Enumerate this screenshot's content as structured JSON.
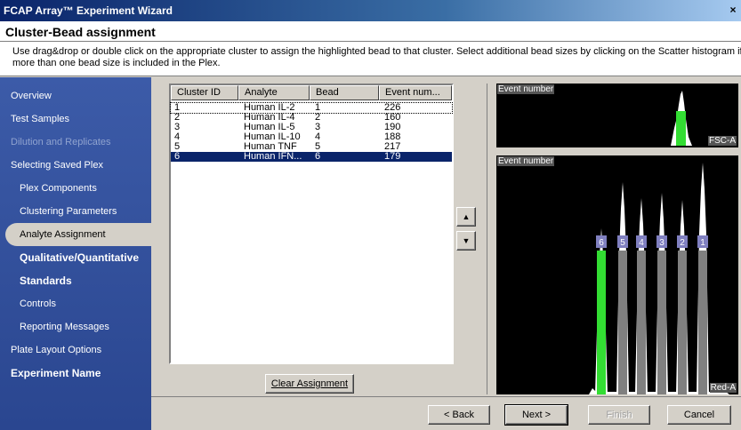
{
  "window": {
    "title": "FCAP Array™ Experiment Wizard",
    "close_glyph": "×"
  },
  "header": {
    "title": "Cluster-Bead assignment",
    "description": "Use drag&drop or double click on the appropriate cluster to assign the highlighted bead to that cluster. Select additional bead sizes by clicking on the Scatter histogram if more than one bead size is included in the Plex."
  },
  "nav": {
    "items": [
      {
        "label": "Overview",
        "level": 0,
        "state": "normal"
      },
      {
        "label": "Test Samples",
        "level": 0,
        "state": "normal"
      },
      {
        "label": "Dilution and Replicates",
        "level": 0,
        "state": "disabled"
      },
      {
        "label": "Selecting Saved Plex",
        "level": 0,
        "state": "normal"
      },
      {
        "label": "Plex Components",
        "level": 1,
        "state": "normal"
      },
      {
        "label": "Clustering Parameters",
        "level": 1,
        "state": "normal"
      },
      {
        "label": "Analyte Assignment",
        "level": 1,
        "state": "selected"
      },
      {
        "label": "Qualitative/Quantitative",
        "level": 1,
        "state": "bold"
      },
      {
        "label": "Standards",
        "level": 1,
        "state": "bold"
      },
      {
        "label": "Controls",
        "level": 1,
        "state": "normal"
      },
      {
        "label": "Reporting Messages",
        "level": 1,
        "state": "normal"
      },
      {
        "label": "Plate Layout Options",
        "level": 0,
        "state": "normal"
      },
      {
        "label": "Experiment Name",
        "level": 0,
        "state": "bold"
      }
    ]
  },
  "table": {
    "columns": [
      "Cluster ID",
      "Analyte",
      "Bead",
      "Event num..."
    ],
    "rows": [
      {
        "cluster": "1",
        "analyte": "Human IL-2",
        "bead": "1",
        "events": "226",
        "selected": false
      },
      {
        "cluster": "2",
        "analyte": "Human IL-4",
        "bead": "2",
        "events": "160",
        "selected": false
      },
      {
        "cluster": "3",
        "analyte": "Human IL-5",
        "bead": "3",
        "events": "190",
        "selected": false
      },
      {
        "cluster": "4",
        "analyte": "Human IL-10",
        "bead": "4",
        "events": "188",
        "selected": false
      },
      {
        "cluster": "5",
        "analyte": "Human TNF",
        "bead": "5",
        "events": "217",
        "selected": false
      },
      {
        "cluster": "6",
        "analyte": "Human IFN...",
        "bead": "6",
        "events": "179",
        "selected": true
      }
    ]
  },
  "buttons": {
    "clear_assignment": "Clear Assignment",
    "up_glyph": "▲",
    "down_glyph": "▼",
    "back": "< Back",
    "next": "Next >",
    "finish": "Finish",
    "cancel": "Cancel"
  },
  "scatter_plot": {
    "y_label": "Event number",
    "x_label": "FSC-A"
  },
  "bead_plot": {
    "y_label": "Event number",
    "x_label": "Red-A",
    "peaks": [
      "6",
      "5",
      "4",
      "3",
      "2",
      "1"
    ],
    "highlighted_peak": "6"
  },
  "colors": {
    "nav_bg": "#3b5aa6",
    "selection": "#0a246a",
    "highlight_green": "#33dd33",
    "gate_gray": "#808080"
  }
}
